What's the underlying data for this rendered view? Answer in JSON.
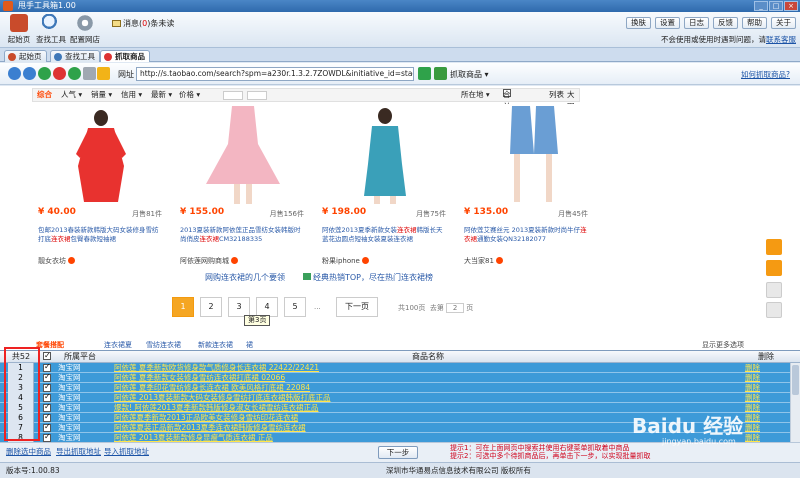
{
  "window": {
    "title": "甩手工具箱1.00"
  },
  "toolbar": {
    "home_label": "起始页",
    "find_tool_label": "查找工具",
    "config_shop_label": "配置网店",
    "message_prefix": "消息(",
    "message_count": "0",
    "message_suffix": ")条未读",
    "right_buttons": [
      "换肤",
      "设置",
      "日志",
      "反馈",
      "帮助",
      "关于"
    ],
    "notice_text": "不会使用或使用时遇到问题，请",
    "notice_link": "联系客服"
  },
  "tabs": [
    {
      "label": "起始页"
    },
    {
      "label": "查找工具"
    },
    {
      "label": "抓取商品"
    }
  ],
  "browser": {
    "url_label": "网址",
    "url": "http://s.taobao.com/search?spm=a230r.1.3.2.7ZOWDL&initiative_id=staobaoz_201",
    "grab_label": "抓取商品 ▾",
    "howto_link": "如何抓取商品?"
  },
  "filters": {
    "items": [
      "综合",
      "人气 ▾",
      "销量 ▾",
      "信用 ▾",
      "最新 ▾",
      "价格 ▾"
    ],
    "location": "所在地 ▾",
    "merge_seller": "合并卖家",
    "list_view": "列表",
    "grid_view": "大图"
  },
  "products": [
    {
      "title_pre": "包邮2013春装新款韩版大码女装修身雪纺打底",
      "title_hl": "连衣裙",
      "title_post": "包臀春款短袖裙",
      "price": "¥ 40.00",
      "sold": "月售81件",
      "shop": "靓女衣坊"
    },
    {
      "title_pre": "2013夏装新款阿依莲正品雪纺女装韩版时尚俏皮",
      "title_hl": "连衣裙",
      "title_post": "CM32188335",
      "price": "¥ 155.00",
      "sold": "月售156件",
      "shop": "阿依莲网购商城"
    },
    {
      "title_pre": "阿依莲2013夏季新款女装",
      "title_hl": "连衣裙",
      "title_post": "韩版长天蓝花边圆点短袖女装夏装连衣裙",
      "price": "¥ 198.00",
      "sold": "月售75件",
      "shop": "粉果iphone"
    },
    {
      "title_pre": "阿依莲艾赛丝元 2013夏装新款时尚牛仔",
      "title_hl": "连衣裙",
      "title_post": "通勤女装QN32182077",
      "price": "¥ 135.00",
      "sold": "月售45件",
      "shop": "大当家81"
    }
  ],
  "hot": {
    "link1": "网购连衣裙的几个要领",
    "link2": "经典热销TOP，尽在热门连衣裙榜"
  },
  "pager": {
    "pages": [
      "1",
      "2",
      "3",
      "4",
      "5"
    ],
    "ellipsis": "...",
    "next": "下一页",
    "total": "共100页",
    "goto": "去第",
    "goto_page": "2",
    "page_unit": "页",
    "tooltip": "第3页"
  },
  "strip": {
    "tagged": "套餐搭配",
    "items": [
      "连衣裙夏",
      "雪纺连衣裙",
      "新款连衣裙",
      "裙"
    ],
    "show_all": "显示更多选项"
  },
  "grid": {
    "count_label": "共52",
    "col_platform": "所属平台",
    "col_name": "商品名称",
    "col_delete": "删除",
    "rows": [
      {
        "num": "1",
        "platform": "淘宝网",
        "name": "阿依莲 夏季新款欧货修身款气质修身长连衣裙 22422/22421",
        "del": "删除"
      },
      {
        "num": "2",
        "platform": "淘宝网",
        "name": "阿依莲 夏季新款女装修身雪纺连衣裙打底裙 02066",
        "del": "删除"
      },
      {
        "num": "3",
        "platform": "淘宝网",
        "name": "阿依莲 夏季印花雪纺修身长连衣裙 欧美风格打底裙 22084",
        "del": "删除"
      },
      {
        "num": "4",
        "platform": "淘宝网",
        "name": "阿依莲 2013夏装新款大码女装修身雪纺打底连衣裙韩版打底正品",
        "del": "删除"
      },
      {
        "num": "5",
        "platform": "淘宝网",
        "name": "爆款! 阿依莲2013夏季新款韩版修身淑女长裙雪纺连衣裙正品",
        "del": "删除"
      },
      {
        "num": "6",
        "platform": "淘宝网",
        "name": "阿依莲夏季新款2013正品欧美女装修身雪纺印花连衣裙",
        "del": "删除"
      },
      {
        "num": "7",
        "platform": "淘宝网",
        "name": "阿依莲夏装正品新款2013夏季连衣裙韩版修身雪纺连衣裙",
        "del": "删除"
      },
      {
        "num": "8",
        "platform": "淘宝网",
        "name": "阿依莲 2013夏装新款修身显瘦气质连衣裙 正品",
        "del": "删除"
      }
    ]
  },
  "actions": {
    "delete_selected": "删除选中商品",
    "export_links": "导出抓取地址",
    "import_links": "导入抓取地址",
    "next_step": "下一步",
    "tip1": "提示1：可在上面网页中搜索并使用右键菜单抓取着中商品",
    "tip2": "提示2：可选中多个待抓商品后，再单击下一步，以实现批量抓取"
  },
  "status": {
    "version": "版本号:1.00.83",
    "copyright": "深圳市华通易点信息技术有限公司 版权所有"
  },
  "watermark": {
    "text": "Baidu 经验",
    "sub": "jingyan.baidu.com"
  }
}
